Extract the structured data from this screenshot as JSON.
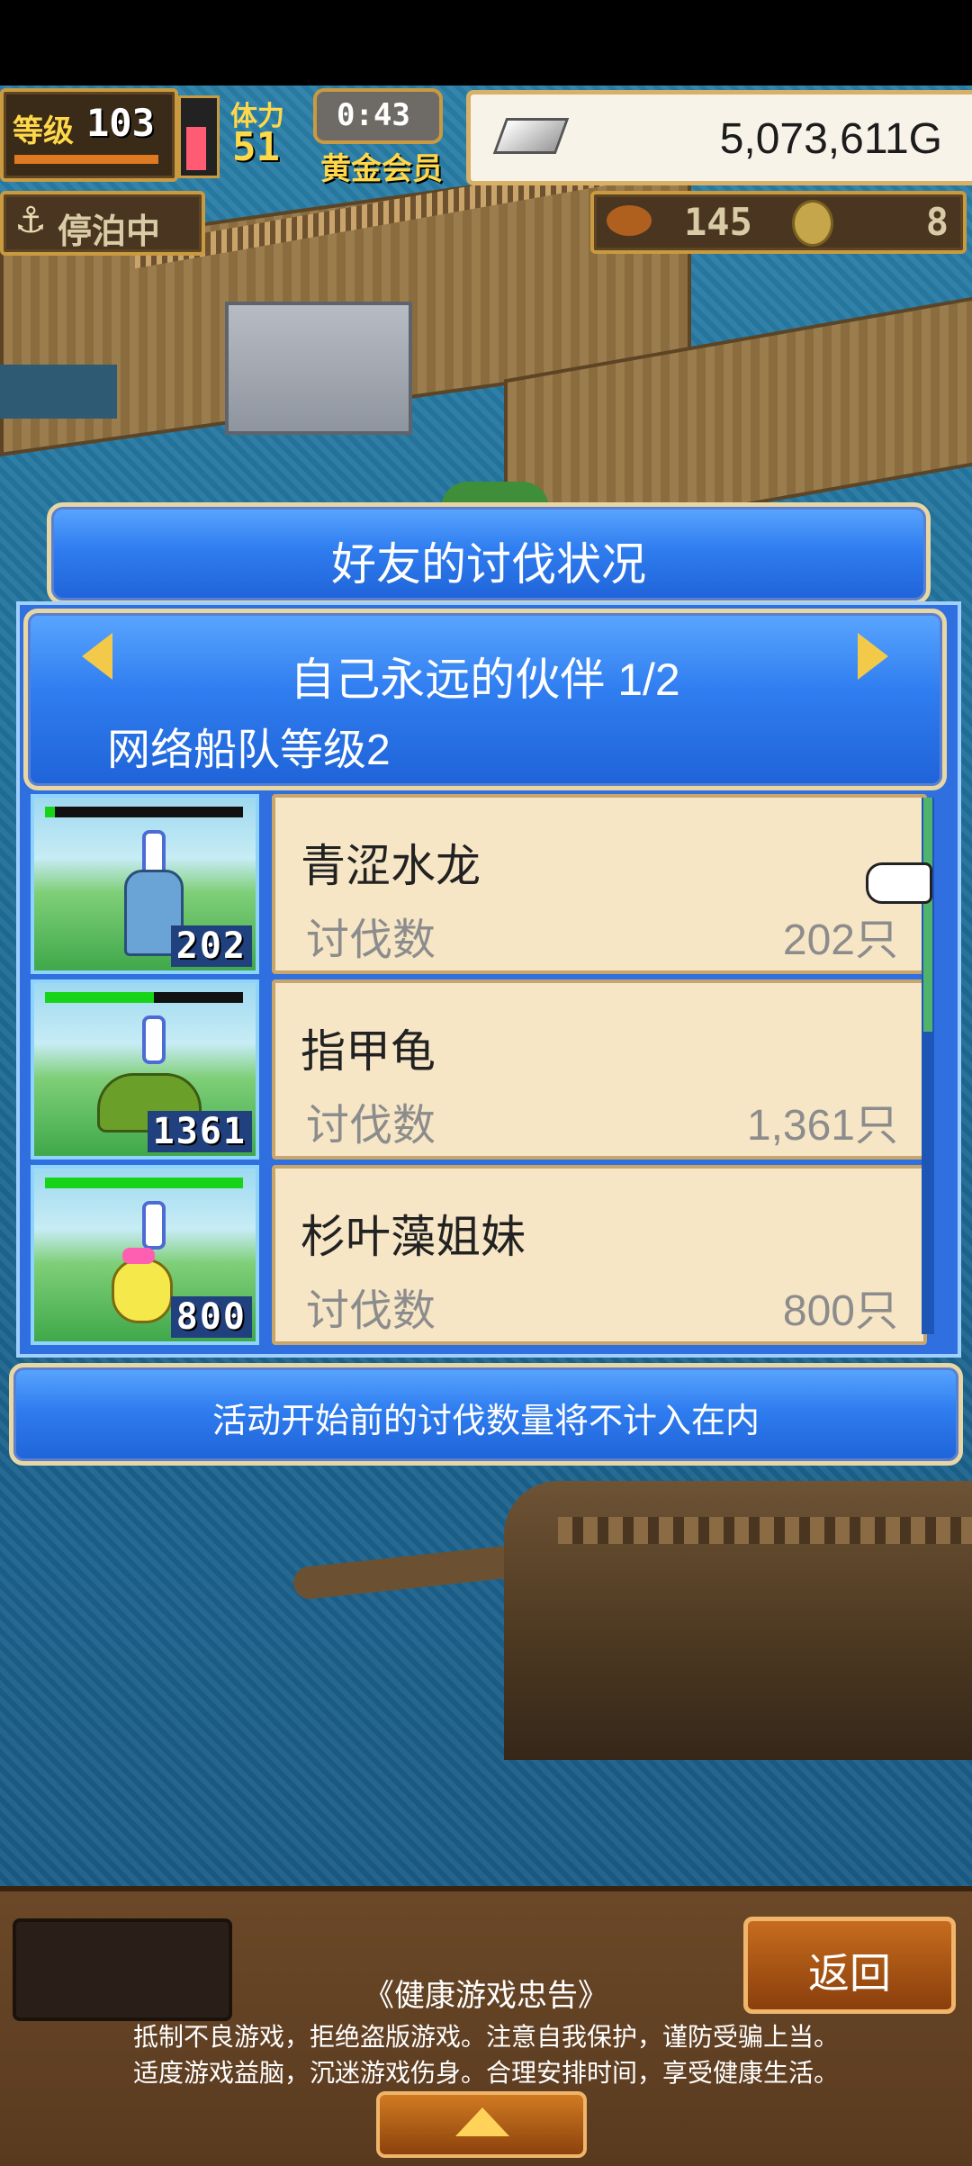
{
  "hud": {
    "level_label": "等级",
    "level_value": "103",
    "stamina_label": "体力",
    "stamina_value": "51",
    "timer": "0:43",
    "membership": "黄金会员",
    "gold": "5,073,611G",
    "dock_status": "停泊中",
    "food_count": "145",
    "coin_count": "8",
    "icons": [
      "anchor-icon",
      "silver-ingot-icon",
      "food-icon",
      "coin-icon"
    ]
  },
  "dialog": {
    "title": "好友的讨伐状况",
    "header": {
      "friend": "自己永远的伙伴 1/2",
      "fleet_level": "网络船队等级2",
      "prev_icon": "left-arrow-icon",
      "next_icon": "right-arrow-icon"
    },
    "rows": [
      {
        "name": "青涩水龙",
        "label": "讨伐数",
        "count": "202只",
        "thumb_count": "202",
        "hp": 0.05
      },
      {
        "name": "指甲龟",
        "label": "讨伐数",
        "count": "1,361只",
        "thumb_count": "1361",
        "hp": 0.55
      },
      {
        "name": "杉叶藻姐妹",
        "label": "讨伐数",
        "count": "800只",
        "thumb_count": "800",
        "hp": 1.0
      }
    ],
    "note": "活动开始前的讨伐数量将不计入在内"
  },
  "bottom": {
    "back_label": "返回",
    "advisory_title": "《健康游戏忠告》",
    "advisory_line1": "抵制不良游戏，拒绝盗版游戏。注意自我保护，谨防受骗上当。",
    "advisory_line2": "适度游戏益脑，沉迷游戏伤身。合理安排时间，享受健康生活。",
    "expand_icon": "up-arrow-icon"
  },
  "colors": {
    "dialog_blue": "#2f7df0",
    "card_bg": "#f6e6c6",
    "hp_green": "#18d418",
    "gold_border": "#e8d7a3"
  }
}
